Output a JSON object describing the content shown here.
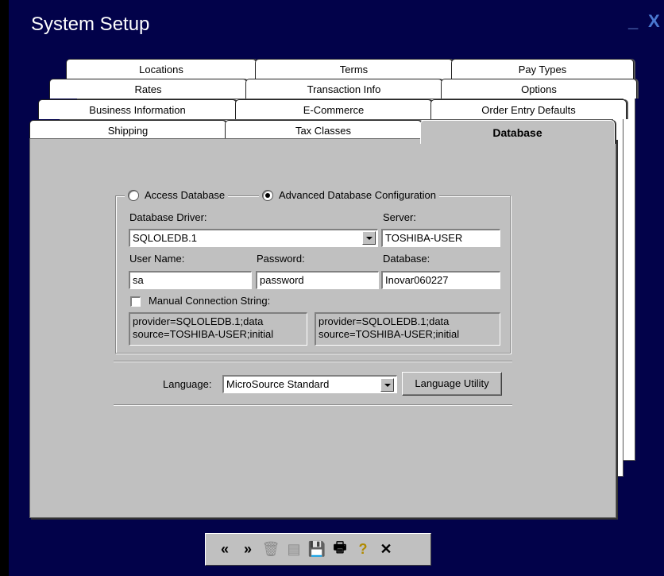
{
  "window": {
    "title": "System Setup",
    "minimize": "_",
    "close": "X"
  },
  "tabs": {
    "row1": [
      "Locations",
      "Terms",
      "Pay Types"
    ],
    "row2": [
      "Rates",
      "Transaction Info",
      "Options"
    ],
    "row3": [
      "Business Information",
      "E-Commerce",
      "Order Entry Defaults"
    ],
    "row4": [
      "Shipping",
      "Tax Classes",
      "Database"
    ]
  },
  "database": {
    "access_label": "Access Database",
    "advanced_label": "Advanced Database Configuration",
    "driver_label": "Database Driver:",
    "driver_value": "SQLOLEDB.1",
    "server_label": "Server:",
    "server_value": "TOSHIBA-USER",
    "username_label": "User Name:",
    "username_value": "sa",
    "password_label": "Password:",
    "password_value": "password",
    "database_label": "Database:",
    "database_value": "Inovar060227",
    "manual_label": "Manual Connection String:",
    "conn_left": "provider=SQLOLEDB.1;data source=TOSHIBA-USER;initial",
    "conn_right": "provider=SQLOLEDB.1;data source=TOSHIBA-USER;initial"
  },
  "language": {
    "label": "Language:",
    "value": "MicroSource Standard",
    "utility_button": "Language Utility"
  },
  "toolbar": {
    "first": "«",
    "next": "»",
    "delete": "🗑",
    "open": "▤",
    "save": "💾",
    "print": "🖶",
    "help": "?",
    "close": "✕"
  }
}
